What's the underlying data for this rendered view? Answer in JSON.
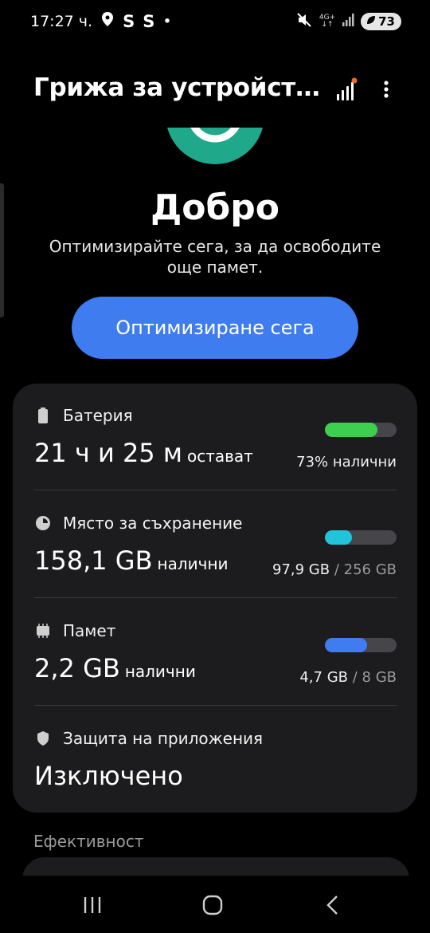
{
  "status_bar": {
    "time": "17:27 ч.",
    "notif1": "S",
    "notif2": "S",
    "dot": "•",
    "network": "4G+",
    "battery": "73"
  },
  "header": {
    "title": "Грижа за устройств..."
  },
  "status": {
    "title": "Добро",
    "description": "Оптимизирайте сега, за да освободите още памет.",
    "button": "Оптимизиране сега"
  },
  "battery": {
    "label": "Батерия",
    "value": "21 ч и 25 м",
    "unit": "остават",
    "detail": "73% налични",
    "level_percent": 73,
    "color": "#3ecf4f"
  },
  "storage": {
    "label": "Място за съхранение",
    "value": "158,1 GB",
    "unit": "налични",
    "used": "97,9 GB",
    "sep": " / ",
    "total": "256 GB",
    "level_percent": 38,
    "color": "#22c4dc"
  },
  "memory": {
    "label": "Памет",
    "value": "2,2 GB",
    "unit": "налични",
    "used": "4,7 GB",
    "sep": " / ",
    "total": "8 GB",
    "level_percent": 59,
    "color": "#3f7cf0"
  },
  "app_protection": {
    "label": "Защита на приложения",
    "value": "Изключено"
  },
  "efficiency": {
    "label": "Ефективност"
  }
}
